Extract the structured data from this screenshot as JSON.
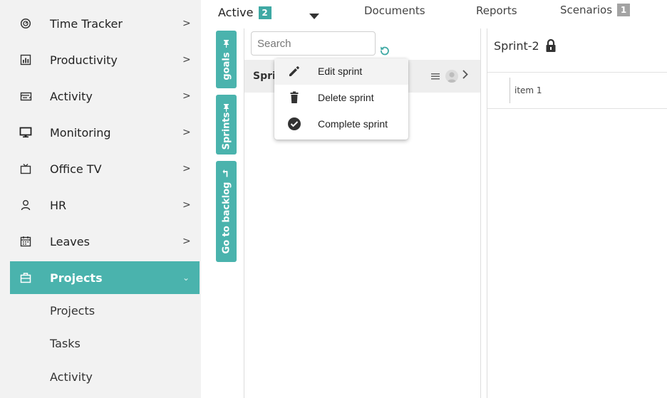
{
  "sidebar": {
    "items": [
      {
        "label": "Time Tracker",
        "icon": "speedometer-icon"
      },
      {
        "label": "Productivity",
        "icon": "bar-chart-icon"
      },
      {
        "label": "Activity",
        "icon": "activity-icon"
      },
      {
        "label": "Monitoring",
        "icon": "monitor-icon"
      },
      {
        "label": "Office TV",
        "icon": "tv-icon"
      },
      {
        "label": "HR",
        "icon": "user-icon"
      },
      {
        "label": "Leaves",
        "icon": "calendar-icon"
      },
      {
        "label": "Projects",
        "icon": "briefcase-icon"
      }
    ],
    "chevron": ">",
    "active_chevron": "⌄",
    "subitems": [
      "Projects",
      "Tasks",
      "Activity"
    ]
  },
  "topbar": {
    "active_label": "Active",
    "active_count": "2",
    "tabs": [
      "Documents",
      "Reports",
      "Scenarios"
    ],
    "scenarios_count": "1"
  },
  "vertical_tabs": [
    "goals",
    "Sprints",
    "Go to backlog"
  ],
  "sprint_list": {
    "search_placeholder": "Search",
    "row_name": "Spri"
  },
  "context_menu": {
    "items": [
      "Edit sprint",
      "Delete sprint",
      "Complete sprint"
    ]
  },
  "detail": {
    "title": "Sprint-2",
    "item": "item 1"
  },
  "colors": {
    "accent": "#4ab3ad",
    "badge_teal": "#3fa9a4",
    "badge_grey": "#a3a3a3",
    "sidebar_bg": "#f2f2f2"
  }
}
